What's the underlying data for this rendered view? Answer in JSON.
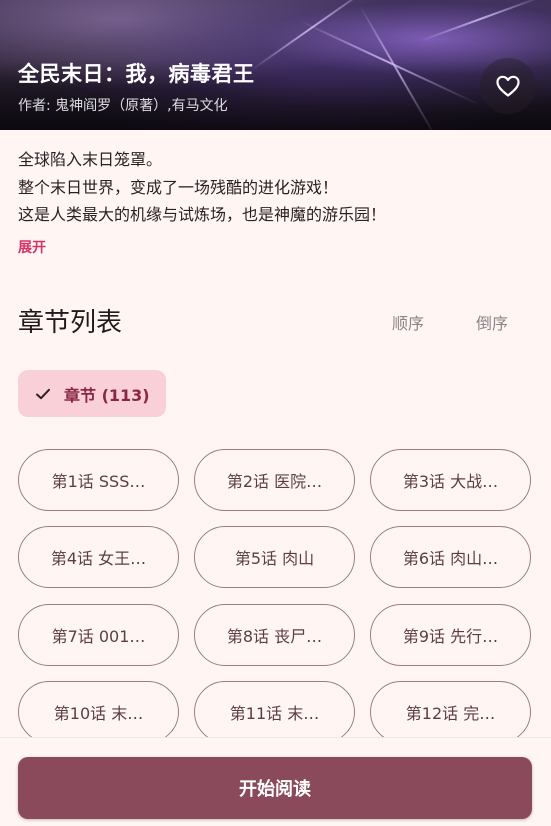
{
  "header": {
    "title": "全民末日：我，病毒君王",
    "author": "作者: 鬼神阎罗（原著）,有马文化",
    "favorite_icon": "heart-outline-icon"
  },
  "description": {
    "lines": [
      "全球陷入末日笼罩。",
      "整个末日世界，变成了一场残酷的进化游戏！",
      "这是人类最大的机缘与试炼场，也是神魔的游乐园！"
    ],
    "expand_label": "展开"
  },
  "chapters": {
    "section_title": "章节列表",
    "sort_asc_label": "顺序",
    "sort_desc_label": "倒序",
    "filter_chip": {
      "label": "章节 (113)",
      "icon": "check-icon",
      "selected": true
    },
    "items": [
      "第1话 SSS…",
      "第2话 医院…",
      "第3话 大战…",
      "第4话 女王…",
      "第5话 肉山",
      "第6话 肉山…",
      "第7话 001…",
      "第8话 丧尸…",
      "第9话 先行…",
      "第10话 末…",
      "第11话 末…",
      "第12话 完…"
    ]
  },
  "footer": {
    "start_reading_label": "开始阅读"
  },
  "colors": {
    "accent_pink": "#d8336b",
    "chip_bg": "#f9cfd8",
    "primary_button": "#8a4a5c",
    "background": "#fff6f4"
  }
}
